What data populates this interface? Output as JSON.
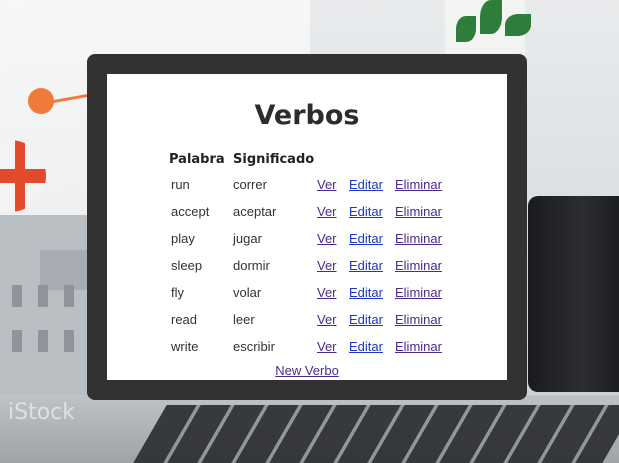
{
  "page": {
    "title": "Verbos",
    "table": {
      "headers": [
        "Palabra",
        "Significado"
      ],
      "rows": [
        {
          "word": "run",
          "meaning": "correr"
        },
        {
          "word": "accept",
          "meaning": "aceptar"
        },
        {
          "word": "play",
          "meaning": "jugar"
        },
        {
          "word": "sleep",
          "meaning": "dormir"
        },
        {
          "word": "fly",
          "meaning": "volar"
        },
        {
          "word": "read",
          "meaning": "leer"
        },
        {
          "word": "write",
          "meaning": "escribir"
        }
      ],
      "actions": {
        "view": "Ver",
        "edit": "Editar",
        "delete": "Eliminar"
      }
    },
    "new_link": "New Verbo"
  },
  "background": {
    "watermark": "iStock"
  },
  "colors": {
    "card": "#323232",
    "panel": "#ffffff",
    "visited_link": "#4b2a8f",
    "link": "#1a37c8"
  }
}
